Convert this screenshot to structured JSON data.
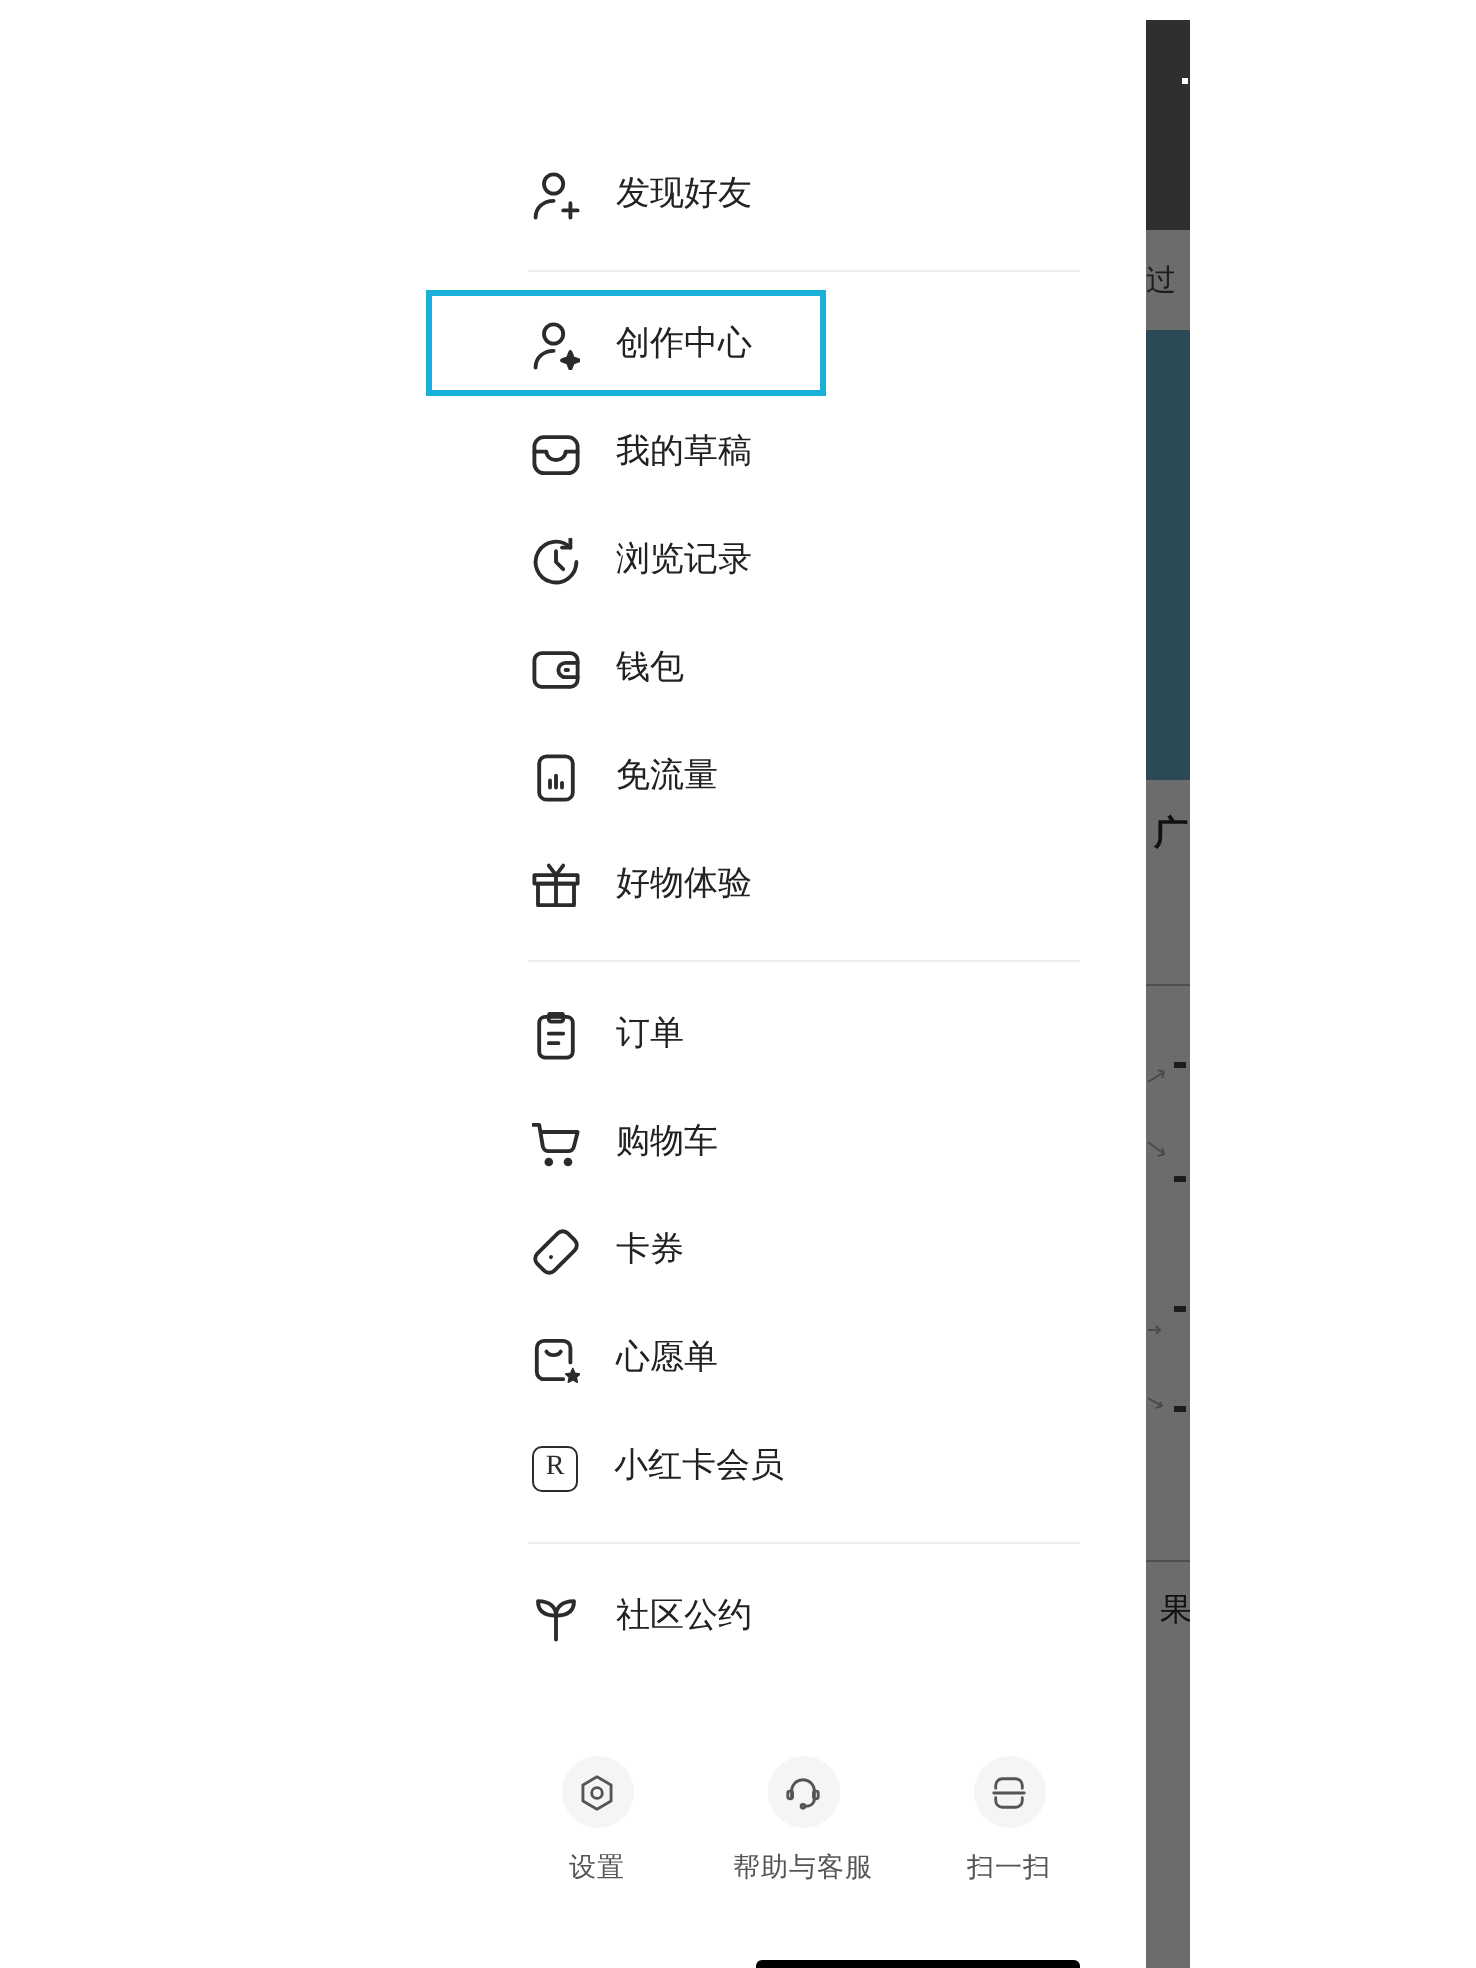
{
  "menu_sections": [
    {
      "items": [
        {
          "label": "发现好友",
          "highlighted": false
        }
      ]
    },
    {
      "items": [
        {
          "label": "创作中心",
          "highlighted": true
        },
        {
          "label": "我的草稿",
          "highlighted": false
        },
        {
          "label": "浏览记录",
          "highlighted": false
        },
        {
          "label": "钱包",
          "highlighted": false
        },
        {
          "label": "免流量",
          "highlighted": false
        },
        {
          "label": "好物体验",
          "highlighted": false
        }
      ]
    },
    {
      "items": [
        {
          "label": "订单",
          "highlighted": false
        },
        {
          "label": "购物车",
          "highlighted": false
        },
        {
          "label": "卡券",
          "highlighted": false
        },
        {
          "label": "心愿单",
          "highlighted": false
        },
        {
          "label": "小红卡会员",
          "highlighted": false,
          "icon_text": "R"
        }
      ]
    },
    {
      "items": [
        {
          "label": "社区公约",
          "highlighted": false
        }
      ]
    }
  ],
  "bottom_actions": [
    {
      "label": "设置"
    },
    {
      "label": "帮助与客服"
    },
    {
      "label": "扫一扫"
    }
  ],
  "background_page": {
    "fragments": [
      "过",
      "广",
      "果"
    ]
  }
}
